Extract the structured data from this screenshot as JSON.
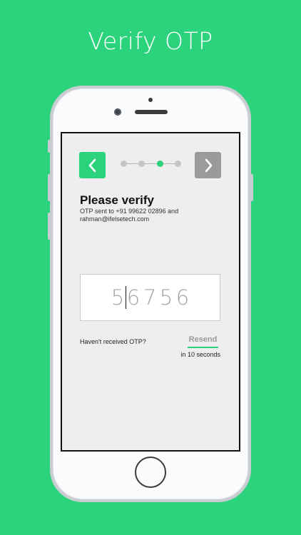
{
  "headline": "Verify OTP",
  "colors": {
    "brand": "#2bd47c",
    "next_button": "#9a9a9a"
  },
  "nav": {
    "back_icon": "chevron-left-icon",
    "next_icon": "chevron-right-icon"
  },
  "steps": {
    "total": 4,
    "current": 3
  },
  "verify": {
    "title": "Please verify",
    "subtitle_line1": "OTP sent to +91 99622  02896 and",
    "subtitle_line2": "rahman@ifelsetech.com"
  },
  "otp": {
    "digits": [
      "5",
      "6",
      "7",
      "5",
      "6"
    ],
    "caret_after_index": 0
  },
  "resend": {
    "prompt": "Haven't received OTP?",
    "label": "Resend",
    "timer": "in 10 seconds"
  }
}
